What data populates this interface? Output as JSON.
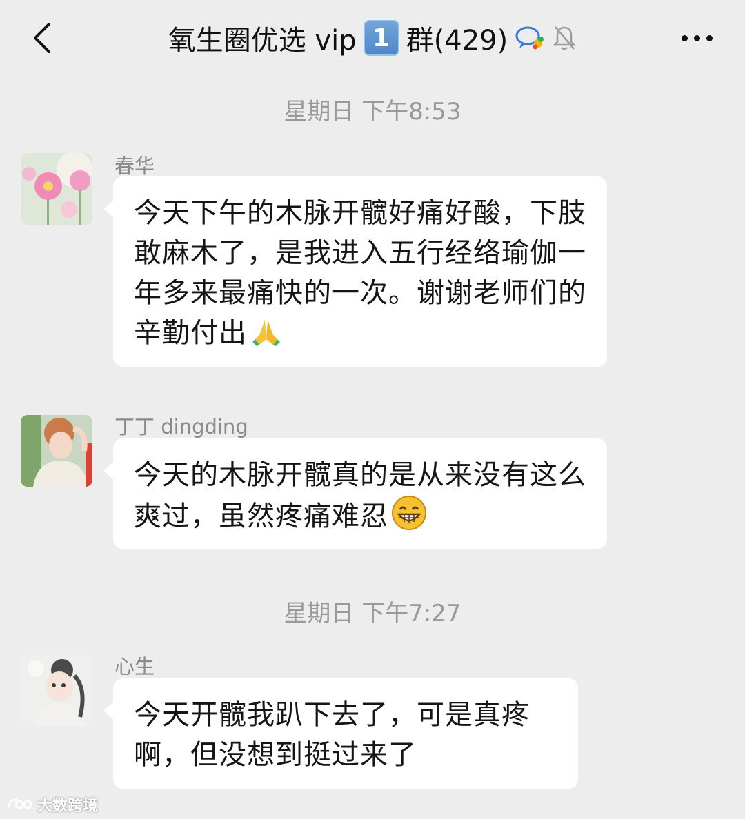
{
  "header": {
    "title_prefix": "氧生圈优选 vip",
    "title_badge": "1",
    "title_suffix": "群(429)",
    "icons": [
      "back-icon",
      "group-chat-icon",
      "mute-bell-icon",
      "more-icon"
    ]
  },
  "chat": {
    "timestamps": [
      "星期日 下午8:53",
      "星期日 下午7:27"
    ],
    "messages": [
      {
        "sender": "春华",
        "text": "今天下午的木脉开髋好痛好酸，下肢敢麻木了，是我进入五行经络瑜伽一年多来最痛快的一次。谢谢老师们的辛勤付出",
        "emoji": "🙏"
      },
      {
        "sender": "丁丁 dingding",
        "text": "今天的木脉开髋真的是从来没有这么爽过，虽然疼痛难忍",
        "emoji": "😁"
      },
      {
        "sender": "心生",
        "text": "今天开髋我趴下去了，可是真疼啊，但没想到挺过来了",
        "emoji": ""
      }
    ]
  },
  "watermark": {
    "text": "大数跨境"
  },
  "colors": {
    "background": "#ededed",
    "bubble": "#ffffff",
    "timestamp": "#9a9a9a",
    "sender": "#8a8a8a",
    "badge": "#5b8fcc"
  }
}
